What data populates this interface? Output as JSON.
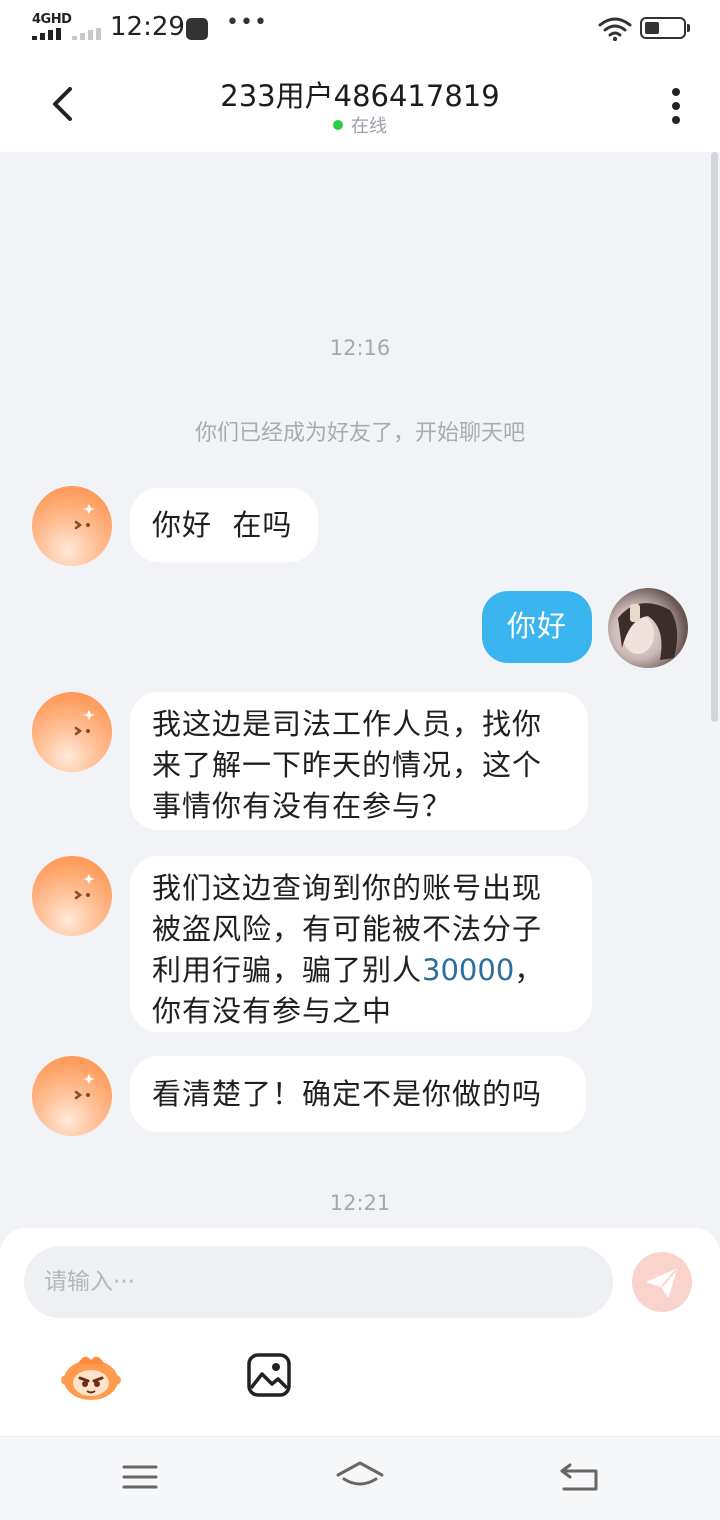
{
  "status_bar": {
    "network": "4GHD",
    "time": "12:29",
    "icons": [
      "signal-bars-icon",
      "notification-icon",
      "more-dots-icon",
      "wifi-icon",
      "battery-icon"
    ]
  },
  "header": {
    "title": "233用户486417819",
    "status": "在线",
    "icons": [
      "back-arrow-icon",
      "more-vertical-icon"
    ]
  },
  "chat": {
    "time_1": "12:16",
    "system_message": "你们已经成为好友了，开始聊天吧",
    "messages": [
      {
        "from": "them",
        "text": "你好  在吗"
      },
      {
        "from": "me",
        "text": "你好"
      },
      {
        "from": "them",
        "text_lines": [
          "我这边是司法工作人员，找你",
          "来了解一下昨天的情况，这个",
          "事情你有没有在参与？"
        ]
      },
      {
        "from": "them",
        "line1": "我们这边查询到你的账号出现",
        "line2": "被盗风险，有可能被不法分子",
        "line3_pre": "利用行骗，骗了别人",
        "line3_num": "30000",
        "line3_post": "，",
        "line4": "你有没有参与之中"
      },
      {
        "from": "them",
        "text": "看清楚了！确定不是你做的吗"
      }
    ],
    "time_2": "12:21"
  },
  "input_bar": {
    "placeholder": "请输入···",
    "value": "",
    "icons": [
      "send-icon",
      "emoji-mascot-icon",
      "image-icon"
    ]
  },
  "nav_bar": {
    "icons": [
      "menu-icon",
      "home-icon",
      "back-icon"
    ]
  },
  "colors": {
    "accent_blue": "#3ab5f0",
    "online_green": "#2ecc40",
    "avatar_orange": "#ff9d5e",
    "send_disabled": "#fbd3cd",
    "background": "#f1f3f7"
  }
}
